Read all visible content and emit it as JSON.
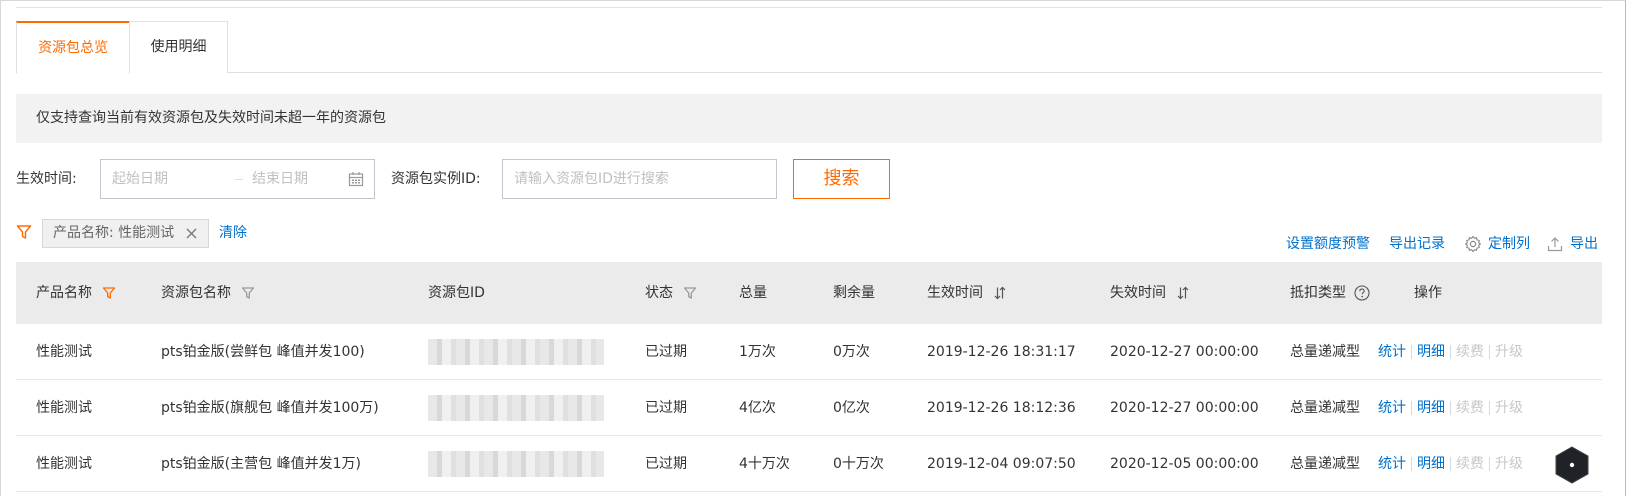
{
  "tabs": [
    {
      "label": "资源包总览",
      "active": true
    },
    {
      "label": "使用明细",
      "active": false
    }
  ],
  "notice": "仅支持查询当前有效资源包及失效时间未超一年的资源包",
  "search": {
    "time_label": "生效时间:",
    "start_placeholder": "起始日期",
    "end_placeholder": "结束日期",
    "id_label": "资源包实例ID:",
    "id_placeholder": "请输入资源包ID进行搜索",
    "button": "搜索"
  },
  "filter": {
    "tag": "产品名称: 性能测试",
    "clear": "清除"
  },
  "actions": {
    "quota_alert": "设置额度预警",
    "export_records": "导出记录",
    "custom_columns": "定制列",
    "export": "导出"
  },
  "table": {
    "headers": {
      "product": "产品名称",
      "package_name": "资源包名称",
      "package_id": "资源包ID",
      "status": "状态",
      "total": "总量",
      "remaining": "剩余量",
      "start": "生效时间",
      "end": "失效时间",
      "deduct": "抵扣类型",
      "ops": "操作"
    },
    "rows": [
      {
        "product": "性能测试",
        "package_name": "pts铂金版(尝鲜包 峰值并发100)",
        "status": "已过期",
        "total": "1万次",
        "remaining": "0万次",
        "start": "2019-12-26 18:31:17",
        "end": "2020-12-27 00:00:00",
        "deduct": "总量递减型"
      },
      {
        "product": "性能测试",
        "package_name": "pts铂金版(旗舰包 峰值并发100万)",
        "status": "已过期",
        "total": "4亿次",
        "remaining": "0亿次",
        "start": "2019-12-26 18:12:36",
        "end": "2020-12-27 00:00:00",
        "deduct": "总量递减型"
      },
      {
        "product": "性能测试",
        "package_name": "pts铂金版(主营包 峰值并发1万)",
        "status": "已过期",
        "total": "4十万次",
        "remaining": "0十万次",
        "start": "2019-12-04 09:07:50",
        "end": "2020-12-05 00:00:00",
        "deduct": "总量递减型"
      }
    ],
    "ops": {
      "stats": "统计",
      "detail": "明细",
      "renew": "续费",
      "upgrade": "升级"
    }
  },
  "colors": {
    "accent": "#ff6a00",
    "link": "#0070cc",
    "disabled": "#c8c8c8"
  }
}
